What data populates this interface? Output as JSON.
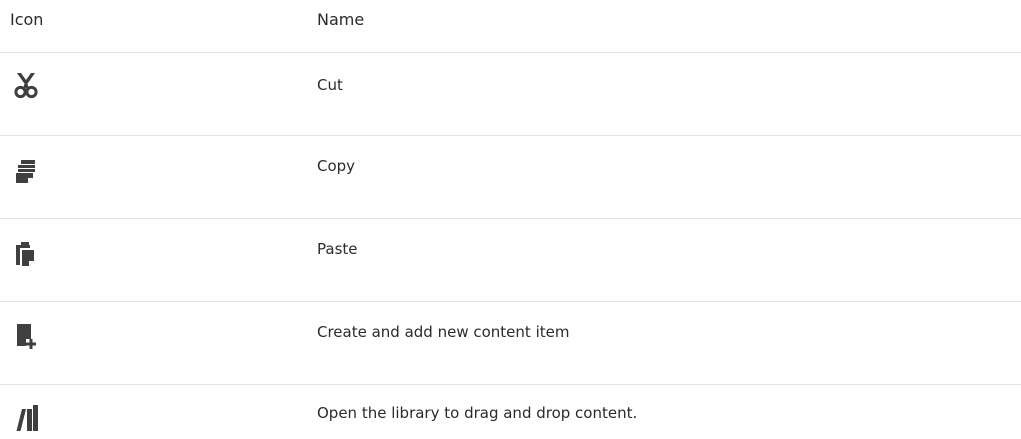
{
  "table": {
    "headers": {
      "icon": "Icon",
      "name": "Name"
    },
    "rows": [
      {
        "icon": "cut-scissors-icon",
        "name": "Cut"
      },
      {
        "icon": "copy-icon",
        "name": "Copy"
      },
      {
        "icon": "paste-icon",
        "name": "Paste"
      },
      {
        "icon": "create-content-item-icon",
        "name": "Create and add new content item"
      },
      {
        "icon": "library-icon",
        "name": "Open the library to drag and drop content."
      }
    ]
  },
  "colors": {
    "icon": "#3f3f3f",
    "divider": "#e3e3e3",
    "text": "#2b2b2b"
  }
}
